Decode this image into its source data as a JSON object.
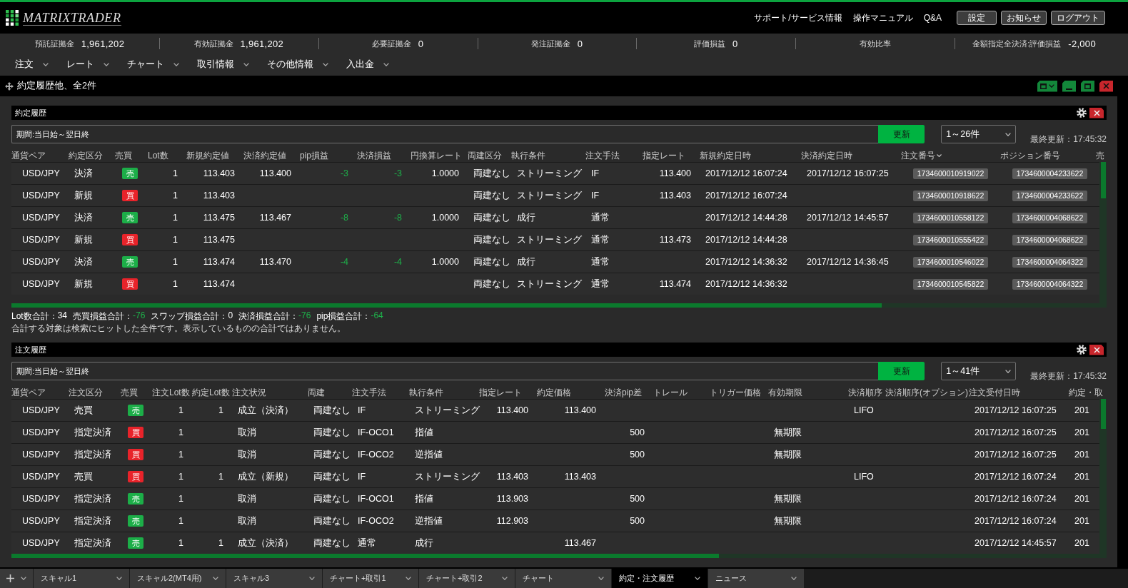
{
  "header": {
    "logo": "MATRIXTRADER",
    "links": [
      "サポート/サービス情報",
      "操作マニュアル",
      "Q&A"
    ],
    "buttons": [
      "設定",
      "お知らせ",
      "ログアウト"
    ]
  },
  "summary": [
    {
      "label": "預託証拠金",
      "value": "1,961,202"
    },
    {
      "label": "有効証拠金",
      "value": "1,961,202"
    },
    {
      "label": "必要証拠金",
      "value": "0"
    },
    {
      "label": "発注証拠金",
      "value": "0"
    },
    {
      "label": "評価損益",
      "value": "0"
    },
    {
      "label": "有効比率"
    },
    {
      "label": "金額指定全決済:評価損益",
      "value": "-2,000"
    }
  ],
  "menu": [
    "注文",
    "レート",
    "チャート",
    "取引情報",
    "その他情報",
    "入出金"
  ],
  "panel": {
    "title": "約定履歴他、全2件",
    "sections": [
      {
        "title": "約定履歴",
        "period": "期間:当日始～翌日終",
        "update_button": "更新",
        "range": "1～26件",
        "last_updated": "最終更新：17:45:32",
        "columns": [
          {
            "label": "通貨ペア",
            "kind": "symbol",
            "sorted": false
          },
          {
            "label": "約定区分",
            "kind": "text",
            "sorted": false
          },
          {
            "label": "売買",
            "kind": "badge",
            "sorted": false
          },
          {
            "label": "Lot数",
            "kind": "number",
            "sorted": false
          },
          {
            "label": "新規約定値",
            "kind": "number",
            "sorted": false
          },
          {
            "label": "決済約定値",
            "kind": "number",
            "sorted": false
          },
          {
            "label": "pip損益",
            "kind": "profit",
            "sorted": false
          },
          {
            "label": "決済損益",
            "kind": "profit",
            "sorted": false
          },
          {
            "label": "円換算レート",
            "kind": "number",
            "sorted": false
          },
          {
            "label": "両建区分",
            "kind": "text",
            "sorted": false
          },
          {
            "label": "執行条件",
            "kind": "text",
            "sorted": false
          },
          {
            "label": "注文手法",
            "kind": "text",
            "sorted": false
          },
          {
            "label": "指定レート",
            "kind": "number",
            "sorted": false
          },
          {
            "label": "新規約定日時",
            "kind": "text",
            "sorted": false
          },
          {
            "label": "決済約定日時",
            "kind": "text",
            "sorted": false
          },
          {
            "label": "注文番号",
            "kind": "chip",
            "sorted": true
          },
          {
            "label": "ポジション番号",
            "kind": "chip",
            "sorted": false
          },
          {
            "label": "売",
            "sorted": false
          }
        ],
        "rows": [
          [
            "USD/JPY",
            "決済",
            {
              "label": "売",
              "color": "#1cae48"
            },
            "1",
            "113.403",
            "113.400",
            "-3",
            "-3",
            "1.0000",
            "両建なし",
            "ストリーミング",
            "IF",
            "113.400",
            "2017/12/12 16:07:24",
            "2017/12/12 16:07:25",
            "1734600010919022",
            "1734600004233622"
          ],
          [
            "USD/JPY",
            "新規",
            {
              "label": "買",
              "color": "#e8232a"
            },
            "1",
            "113.403",
            null,
            null,
            null,
            null,
            "両建なし",
            "ストリーミング",
            "IF",
            "113.403",
            "2017/12/12 16:07:24",
            null,
            "1734600010918622",
            "1734600004233622"
          ],
          [
            "USD/JPY",
            "決済",
            {
              "label": "売",
              "color": "#1cae48"
            },
            "1",
            "113.475",
            "113.467",
            "-8",
            "-8",
            "1.0000",
            "両建なし",
            "成行",
            "通常",
            null,
            "2017/12/12 14:44:28",
            "2017/12/12 14:45:57",
            "1734600010558122",
            "1734600004068622"
          ],
          [
            "USD/JPY",
            "新規",
            {
              "label": "買",
              "color": "#e8232a"
            },
            "1",
            "113.475",
            null,
            null,
            null,
            null,
            "両建なし",
            "ストリーミング",
            "通常",
            "113.473",
            "2017/12/12 14:44:28",
            null,
            "1734600010555422",
            "1734600004068622"
          ],
          [
            "USD/JPY",
            "決済",
            {
              "label": "売",
              "color": "#1cae48"
            },
            "1",
            "113.474",
            "113.470",
            "-4",
            "-4",
            "1.0000",
            "両建なし",
            "成行",
            "通常",
            null,
            "2017/12/12 14:36:32",
            "2017/12/12 14:36:45",
            "1734600010546022",
            "1734600004064322"
          ],
          [
            "USD/JPY",
            "新規",
            {
              "label": "買",
              "color": "#e8232a"
            },
            "1",
            "113.474",
            null,
            null,
            null,
            null,
            "両建なし",
            "ストリーミング",
            "通常",
            "113.474",
            "2017/12/12 14:36:32",
            null,
            "1734600010545822",
            "1734600004064322"
          ]
        ],
        "totals": [
          {
            "label": "Lot数合計：",
            "value": "34",
            "kind": "count"
          },
          {
            "label": "売買損益合計：",
            "value": "-76",
            "kind": "profit"
          },
          {
            "label": "スワップ損益合計：",
            "value": "0",
            "kind": "count"
          },
          {
            "label": "決済損益合計：",
            "value": "-76",
            "kind": "profit"
          },
          {
            "label": "pip損益合計：",
            "value": "-64",
            "kind": "profit"
          }
        ],
        "note": "合計する対象は検索にヒットした全件です。表示しているものの合計ではありません。"
      },
      {
        "title": "注文履歴",
        "period": "期間:当日始～翌日終",
        "update_button": "更新",
        "range": "1～41件",
        "last_updated": "最終更新：17:45:32",
        "columns": [
          {
            "label": "通貨ペア",
            "kind": "symbol"
          },
          {
            "label": "注文区分",
            "kind": "text"
          },
          {
            "label": "売買",
            "kind": "badge"
          },
          {
            "label": "注文Lot数",
            "kind": "number"
          },
          {
            "label": "約定Lot数",
            "kind": "number"
          },
          {
            "label": "注文状況",
            "kind": "text"
          },
          {
            "label": "両建",
            "kind": "text"
          },
          {
            "label": "注文手法",
            "kind": "text"
          },
          {
            "label": "執行条件",
            "kind": "text"
          },
          {
            "label": "指定レート",
            "kind": "number"
          },
          {
            "label": "約定価格",
            "kind": "number"
          },
          {
            "label": "決済pip差",
            "kind": "number"
          },
          {
            "label": "トレール"
          },
          {
            "label": "トリガー価格"
          },
          {
            "label": "有効期限",
            "kind": "text"
          },
          {
            "label": "決済順序",
            "kind": "text"
          },
          {
            "label": "決済順序(オプション)"
          },
          {
            "label": "注文受付日時",
            "kind": "text"
          },
          {
            "label": "約定・取",
            "kind": "text"
          }
        ],
        "rows": [
          [
            "USD/JPY",
            "売買",
            {
              "label": "売",
              "color": "#1cae48"
            },
            "1",
            "1",
            "成立（決済）",
            "両建なし",
            "IF",
            "ストリーミング",
            "113.400",
            "113.400",
            null,
            null,
            null,
            null,
            "LIFO",
            null,
            "2017/12/12 16:07:25",
            "201"
          ],
          [
            "USD/JPY",
            "指定決済",
            {
              "label": "買",
              "color": "#e8232a"
            },
            "1",
            null,
            "取消",
            "両建なし",
            "IF-OCO1",
            "指値",
            null,
            null,
            "500",
            null,
            null,
            "無期限",
            null,
            null,
            "2017/12/12 16:07:25",
            "201"
          ],
          [
            "USD/JPY",
            "指定決済",
            {
              "label": "買",
              "color": "#e8232a"
            },
            "1",
            null,
            "取消",
            "両建なし",
            "IF-OCO2",
            "逆指値",
            null,
            null,
            "500",
            null,
            null,
            "無期限",
            null,
            null,
            "2017/12/12 16:07:25",
            "201"
          ],
          [
            "USD/JPY",
            "売買",
            {
              "label": "買",
              "color": "#e8232a"
            },
            "1",
            "1",
            "成立（新規）",
            "両建なし",
            "IF",
            "ストリーミング",
            "113.403",
            "113.403",
            null,
            null,
            null,
            null,
            "LIFO",
            null,
            "2017/12/12 16:07:24",
            "201"
          ],
          [
            "USD/JPY",
            "指定決済",
            {
              "label": "売",
              "color": "#1cae48"
            },
            "1",
            null,
            "取消",
            "両建なし",
            "IF-OCO1",
            "指値",
            "113.903",
            null,
            "500",
            null,
            null,
            "無期限",
            null,
            null,
            "2017/12/12 16:07:24",
            "201"
          ],
          [
            "USD/JPY",
            "指定決済",
            {
              "label": "売",
              "color": "#1cae48"
            },
            "1",
            null,
            "取消",
            "両建なし",
            "IF-OCO2",
            "逆指値",
            "112.903",
            null,
            "500",
            null,
            null,
            "無期限",
            null,
            null,
            "2017/12/12 16:07:24",
            "201"
          ],
          [
            "USD/JPY",
            "指定決済",
            {
              "label": "売",
              "color": "#1cae48"
            },
            "1",
            "1",
            "成立（決済）",
            "両建なし",
            "通常",
            "成行",
            null,
            "113.467",
            null,
            null,
            null,
            null,
            null,
            null,
            "2017/12/12 14:45:57",
            "201"
          ]
        ]
      }
    ]
  },
  "tabs": [
    {
      "label": "スキャル1",
      "selected": false
    },
    {
      "label": "スキャル2(MT4用)",
      "selected": false
    },
    {
      "label": "スキャル3",
      "selected": false
    },
    {
      "label": "チャート+取引1",
      "selected": false
    },
    {
      "label": "チャート+取引2",
      "selected": false
    },
    {
      "label": "チャート",
      "selected": false
    },
    {
      "label": "約定・注文履歴",
      "selected": true
    },
    {
      "label": "ニュース",
      "selected": false
    }
  ]
}
